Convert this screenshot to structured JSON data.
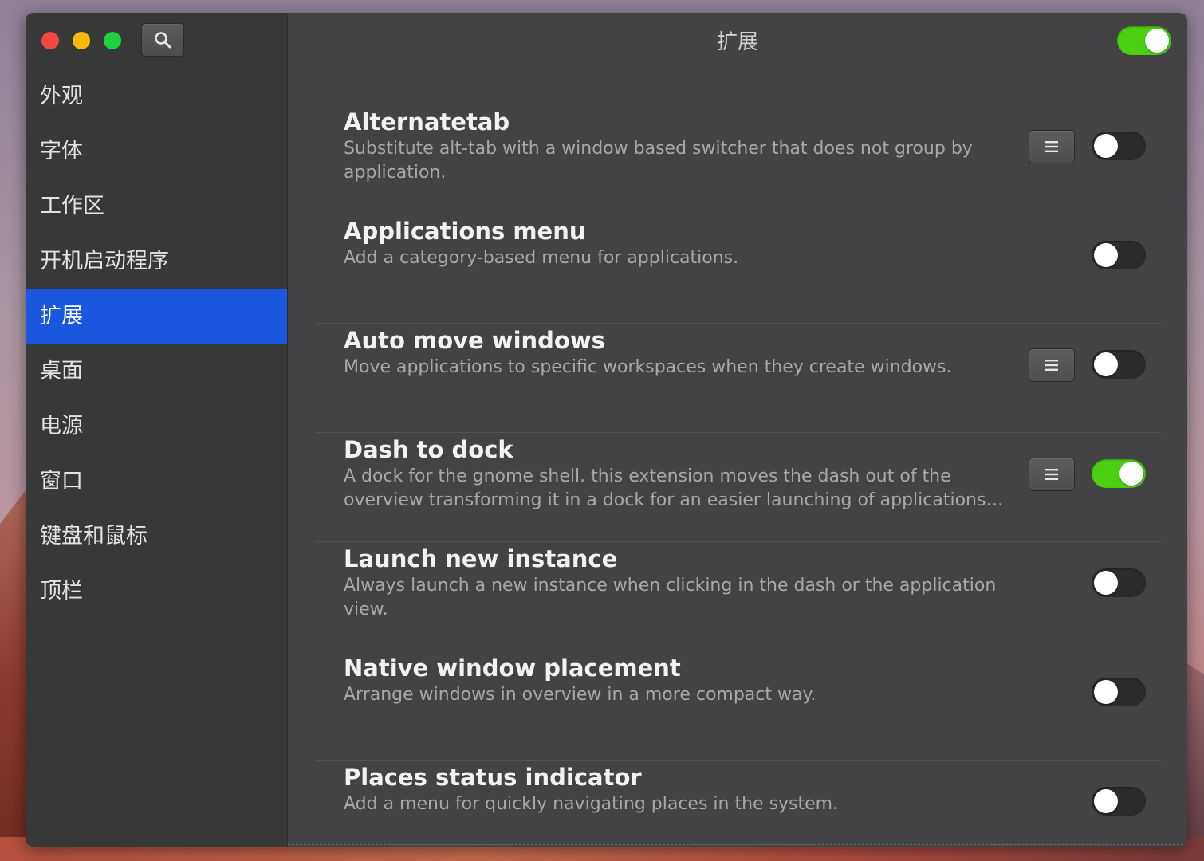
{
  "window": {
    "title": "扩展",
    "global_toggle_on": true
  },
  "sidebar": {
    "items": [
      {
        "label": "外观",
        "active": false
      },
      {
        "label": "字体",
        "active": false
      },
      {
        "label": "工作区",
        "active": false
      },
      {
        "label": "开机启动程序",
        "active": false
      },
      {
        "label": "扩展",
        "active": true
      },
      {
        "label": "桌面",
        "active": false
      },
      {
        "label": "电源",
        "active": false
      },
      {
        "label": "窗口",
        "active": false
      },
      {
        "label": "键盘和鼠标",
        "active": false
      },
      {
        "label": "顶栏",
        "active": false
      }
    ]
  },
  "extensions": [
    {
      "name": "Alternatetab",
      "description": "Substitute alt-tab with a window based switcher that does not group by application.",
      "has_settings": true,
      "enabled": false
    },
    {
      "name": "Applications menu",
      "description": "Add a category-based menu for applications.",
      "has_settings": false,
      "enabled": false
    },
    {
      "name": "Auto move windows",
      "description": "Move applications to specific workspaces when they create windows.",
      "has_settings": true,
      "enabled": false
    },
    {
      "name": "Dash to dock",
      "description": "A dock for the gnome shell. this extension moves the dash out of the overview transforming it in a dock for an easier launching of applications and a faster switching between windows and desktops.",
      "has_settings": true,
      "enabled": true
    },
    {
      "name": "Launch new instance",
      "description": "Always launch a new instance when clicking in the dash or the application view.",
      "has_settings": false,
      "enabled": false
    },
    {
      "name": "Native window placement",
      "description": "Arrange windows in overview in a more compact way.",
      "has_settings": false,
      "enabled": false
    },
    {
      "name": "Places status indicator",
      "description": "Add a menu for quickly navigating places in the system.",
      "has_settings": false,
      "enabled": false
    }
  ],
  "colors": {
    "accent": "#1a56de",
    "toggle_on": "#4cd014",
    "close": "#f5463f",
    "minimize": "#f9b908",
    "maximize": "#1fd23b"
  },
  "icons": {
    "search": "search-icon",
    "settings": "menu-lines-icon"
  }
}
